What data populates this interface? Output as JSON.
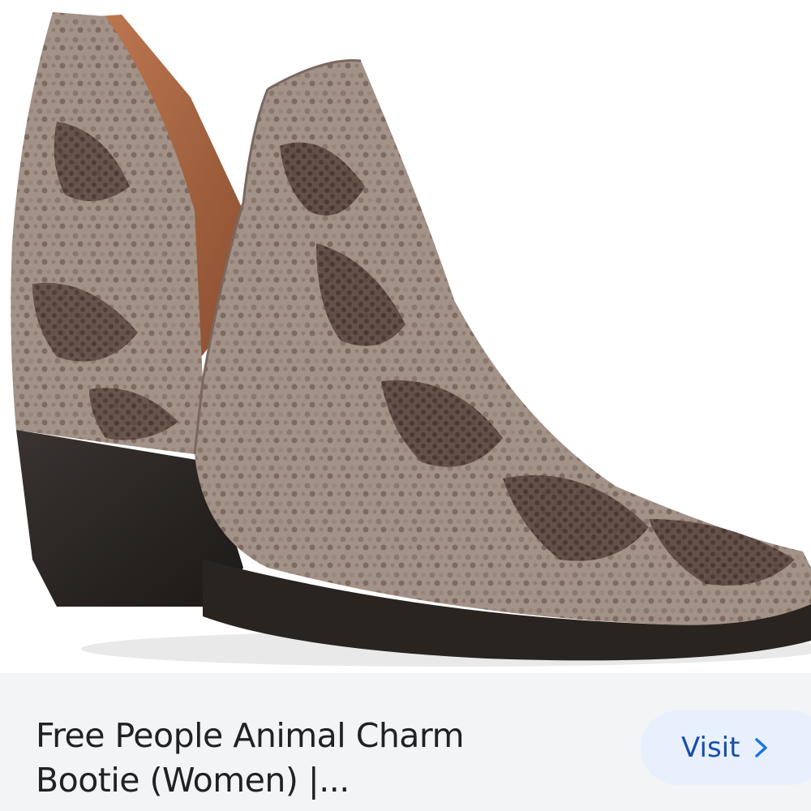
{
  "product": {
    "image_alt": "Snakeskin ankle bootie",
    "title_line1": "Free People Animal Charm",
    "title_line2": "Bootie (Women) |..."
  },
  "actions": {
    "visit_label": "Visit",
    "visit_icon": "chevron-right-icon"
  },
  "colors": {
    "accent": "#1a73e8",
    "button_bg": "#e8f0fe",
    "text": "#202124"
  }
}
